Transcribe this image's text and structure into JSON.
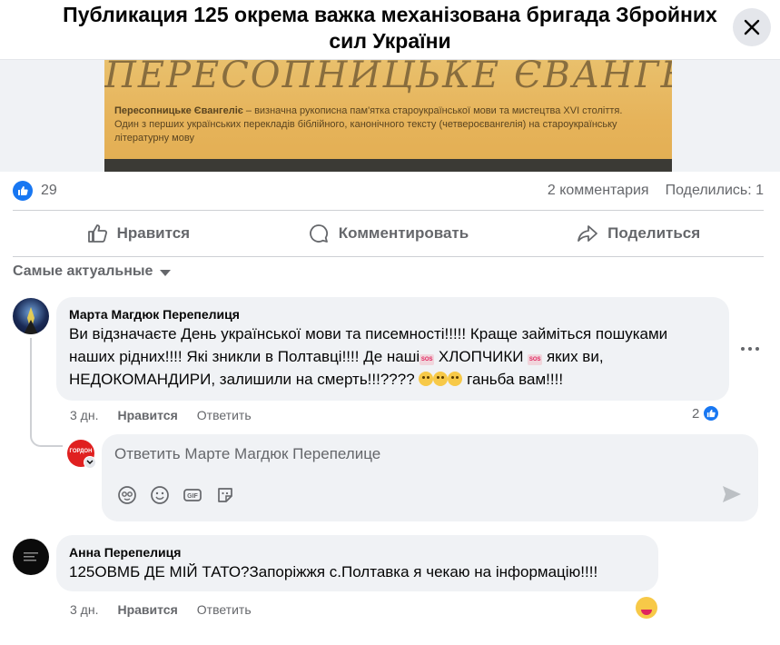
{
  "header": {
    "title": "Публикация 125 окрема важка механізована бригада Збройних сил України"
  },
  "post_image": {
    "caption_bold": "Пересопницьке Євангеліє",
    "caption_rest": " – визначна рукописна пам'ятка староукраїнської мови та мистецтва XVI століття. Один з перших українських перекладів біблійного, канонічного тексту (четвероєвангелія) на староукраїнську літературну мову",
    "script_text": "ПЕРЕСОПНИЦЬКЕ ЄВАНГЕЛІЄ"
  },
  "stats": {
    "likes": "29",
    "comments": "2 комментария",
    "shares": "Поделились: 1"
  },
  "actions": {
    "like": "Нравится",
    "comment": "Комментировать",
    "share": "Поделиться"
  },
  "sort_label": "Самые актуальные",
  "comments": [
    {
      "author": "Марта Магдюк Перепелиця",
      "text_part1": "Ви відзначаєте День української мови та писемності!!!!! Краще займіться пошуками наших рідних!!!! Які зникли в Полтавці!!!! Де наші",
      "text_part2": " ХЛОПЧИКИ ",
      "text_part3": " яких ви, НЕДОКОМАНДИРИ, залишили на смерть!!!????",
      "text_part4": " ганьба вам!!!!",
      "sos_label": "SOS",
      "time": "3 дн.",
      "like": "Нравится",
      "reply": "Ответить",
      "reactions": "2"
    },
    {
      "author": "Анна Перепелиця",
      "text": "125ОВМБ ДЕ МІЙ ТАТО?Запоріжжя с.Полтавка я чекаю на інформацію!!!!",
      "time": "3 дн.",
      "like": "Нравится",
      "reply": "Ответить"
    }
  ],
  "reply_box": {
    "placeholder": "Ответить Марте Магдюк Перепелице",
    "avatar_text": "ГОРДОН"
  },
  "colors": {
    "accent": "#1877f2",
    "text_secondary": "#65676b",
    "bubble": "#f0f2f5"
  }
}
